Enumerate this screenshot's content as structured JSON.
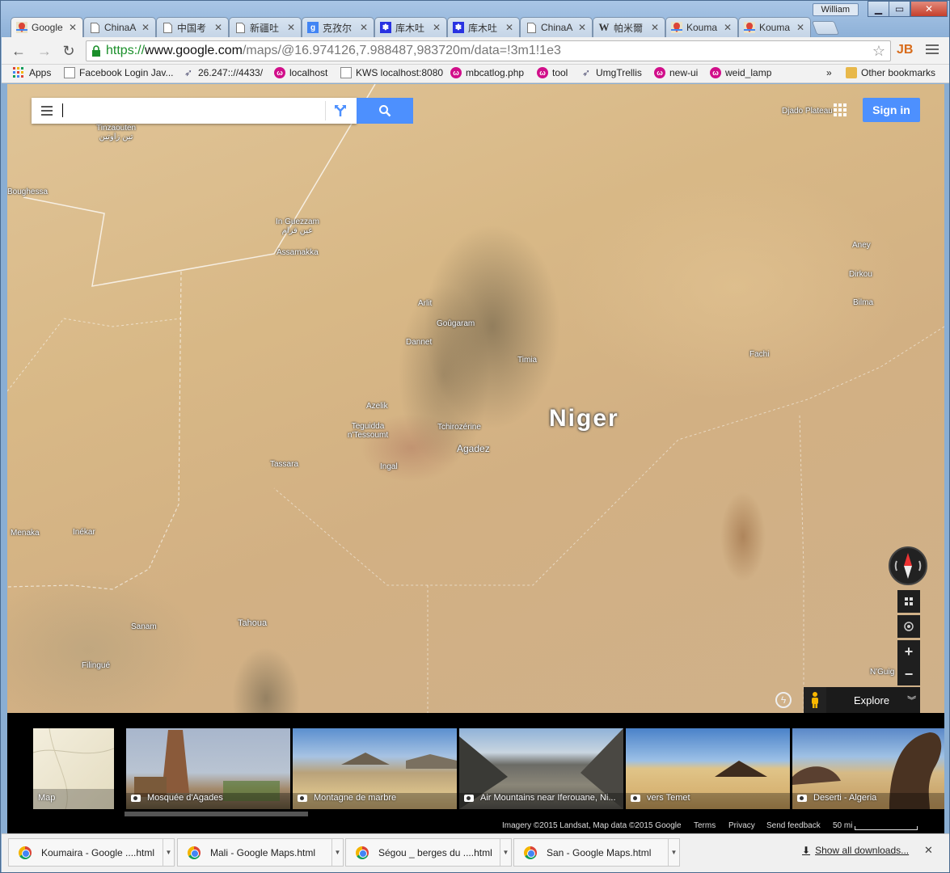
{
  "window": {
    "user": "William"
  },
  "tabs": [
    {
      "title": "Google",
      "icon": "google-maps-icon",
      "active": true
    },
    {
      "title": "ChinaA",
      "icon": "page-icon"
    },
    {
      "title": "中国考",
      "icon": "page-icon"
    },
    {
      "title": "新疆吐",
      "icon": "page-icon"
    },
    {
      "title": "克孜尔",
      "icon": "google-g-icon"
    },
    {
      "title": "库木吐",
      "icon": "baidu-paw-icon"
    },
    {
      "title": "库木吐",
      "icon": "baidu-paw-icon"
    },
    {
      "title": "ChinaA",
      "icon": "page-icon"
    },
    {
      "title": "帕米爾",
      "icon": "wikipedia-icon"
    },
    {
      "title": "Kouma",
      "icon": "google-maps-icon"
    },
    {
      "title": "Kouma",
      "icon": "google-maps-icon"
    }
  ],
  "address_bar": {
    "scheme": "https://",
    "host": "www.google.com",
    "path": "/maps/@16.974126,7.988487,983720m/data=!3m1!1e3"
  },
  "bookmarks": {
    "apps": "Apps",
    "items": [
      {
        "label": "Facebook Login Jav...",
        "icon": "page-icon"
      },
      {
        "label": "26.247:://4433/",
        "icon": "arrow-icon"
      },
      {
        "label": "localhost",
        "icon": "swirl-icon"
      },
      {
        "label": "KWS localhost:8080",
        "icon": "page-icon"
      },
      {
        "label": "mbcatlog.php",
        "icon": "swirl-icon"
      },
      {
        "label": "tool",
        "icon": "swirl-icon"
      },
      {
        "label": "UmgTrellis",
        "icon": "arrow-icon"
      },
      {
        "label": "new-ui",
        "icon": "swirl-icon"
      },
      {
        "label": "weid_lamp",
        "icon": "swirl-icon"
      }
    ],
    "overflow": "»",
    "other": "Other bookmarks"
  },
  "map": {
    "country": "Niger",
    "sign_in": "Sign in",
    "explore": "Explore",
    "places": [
      {
        "name": "Tinzaouten",
        "alt": "تين زاوتين"
      },
      {
        "name": "Boughessa"
      },
      {
        "name": "In Guezzam",
        "alt": "عين قزام"
      },
      {
        "name": "Assamakka"
      },
      {
        "name": "Djado Plateau"
      },
      {
        "name": "Aney"
      },
      {
        "name": "Dirkou"
      },
      {
        "name": "Bilma"
      },
      {
        "name": "Arlit"
      },
      {
        "name": "Goûgaram"
      },
      {
        "name": "Dannet"
      },
      {
        "name": "Timia"
      },
      {
        "name": "Fachi"
      },
      {
        "name": "Azelik"
      },
      {
        "name": "Teguidda n'Tessoumt"
      },
      {
        "name": "Tchirozérine"
      },
      {
        "name": "Agadez"
      },
      {
        "name": "Tassara"
      },
      {
        "name": "Ingal"
      },
      {
        "name": "Menaka"
      },
      {
        "name": "Inékar"
      },
      {
        "name": "Sanam"
      },
      {
        "name": "Tahoua"
      },
      {
        "name": "Filingué"
      },
      {
        "name": "N'Guig"
      }
    ]
  },
  "filmstrip": {
    "thumbs": [
      {
        "caption": "Map",
        "type": "map"
      },
      {
        "caption": "Mosquée d'Agades",
        "type": "photo"
      },
      {
        "caption": "Montagne de marbre",
        "type": "photo"
      },
      {
        "caption": "Air Mountains near Iferouane, Ni...",
        "type": "photo"
      },
      {
        "caption": "vers Temet",
        "type": "photo"
      },
      {
        "caption": "Deserti - Algeria",
        "type": "photo"
      }
    ],
    "footer": {
      "imagery": "Imagery ©2015 Landsat, Map data ©2015 Google",
      "terms": "Terms",
      "privacy": "Privacy",
      "feedback": "Send feedback",
      "scale": "50 mi"
    }
  },
  "downloads": {
    "items": [
      "Koumaira - Google ....html",
      "Mali - Google Maps.html",
      "Ségou _ berges du ....html",
      "San - Google Maps.html"
    ],
    "show_all": "Show all downloads..."
  },
  "colors": {
    "accent_blue": "#4d90fe",
    "url_green": "#1a8f2a",
    "bookmark_swirl": "#d10f8a"
  }
}
